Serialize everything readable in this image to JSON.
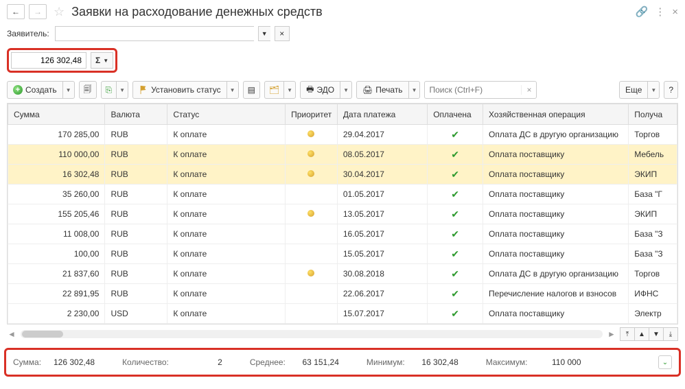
{
  "title": "Заявки на расходование денежных средств",
  "filter": {
    "label": "Заявитель:"
  },
  "sum_field": "126 302,48",
  "toolbar": {
    "create": "Создать",
    "set_status": "Установить статус",
    "edo": "ЭДО",
    "print": "Печать",
    "search_placeholder": "Поиск (Ctrl+F)",
    "more": "Еще"
  },
  "columns": {
    "sum": "Сумма",
    "currency": "Валюта",
    "status": "Статус",
    "priority": "Приоритет",
    "pay_date": "Дата платежа",
    "paid": "Оплачена",
    "operation": "Хозяйственная операция",
    "recipient": "Получа"
  },
  "rows": [
    {
      "sum": "170 285,00",
      "cur": "RUB",
      "status": "К оплате",
      "bulb": true,
      "date": "29.04.2017",
      "paid": true,
      "op": "Оплата ДС в другую организацию",
      "recv": "Торгов",
      "sel": false
    },
    {
      "sum": "110 000,00",
      "cur": "RUB",
      "status": "К оплате",
      "bulb": true,
      "date": "08.05.2017",
      "paid": true,
      "op": "Оплата поставщику",
      "recv": "Мебель",
      "sel": true
    },
    {
      "sum": "16 302,48",
      "cur": "RUB",
      "status": "К оплате",
      "bulb": true,
      "date": "30.04.2017",
      "paid": true,
      "op": "Оплата поставщику",
      "recv": "ЭКИП",
      "sel": true
    },
    {
      "sum": "35 260,00",
      "cur": "RUB",
      "status": "К оплате",
      "bulb": false,
      "date": "01.05.2017",
      "paid": true,
      "op": "Оплата поставщику",
      "recv": "База \"Г",
      "sel": false
    },
    {
      "sum": "155 205,46",
      "cur": "RUB",
      "status": "К оплате",
      "bulb": true,
      "date": "13.05.2017",
      "paid": true,
      "op": "Оплата поставщику",
      "recv": "ЭКИП",
      "sel": false
    },
    {
      "sum": "11 008,00",
      "cur": "RUB",
      "status": "К оплате",
      "bulb": false,
      "date": "16.05.2017",
      "paid": true,
      "op": "Оплата поставщику",
      "recv": "База \"З",
      "sel": false
    },
    {
      "sum": "100,00",
      "cur": "RUB",
      "status": "К оплате",
      "bulb": false,
      "date": "15.05.2017",
      "paid": true,
      "op": "Оплата поставщику",
      "recv": "База \"З",
      "sel": false
    },
    {
      "sum": "21 837,60",
      "cur": "RUB",
      "status": "К оплате",
      "bulb": true,
      "date": "30.08.2018",
      "paid": true,
      "op": "Оплата ДС в другую организацию",
      "recv": "Торгов",
      "sel": false
    },
    {
      "sum": "22 891,95",
      "cur": "RUB",
      "status": "К оплате",
      "bulb": false,
      "date": "22.06.2017",
      "paid": true,
      "op": "Перечисление налогов и взносов",
      "recv": "ИФНС",
      "sel": false
    },
    {
      "sum": "2 230,00",
      "cur": "USD",
      "status": "К оплате",
      "bulb": false,
      "date": "15.07.2017",
      "paid": true,
      "op": "Оплата поставщику",
      "recv": "Электр",
      "sel": false
    }
  ],
  "footer": {
    "sum_label": "Сумма:",
    "sum_value": "126 302,48",
    "count_label": "Количество:",
    "count_value": "2",
    "avg_label": "Среднее:",
    "avg_value": "63 151,24",
    "min_label": "Минимум:",
    "min_value": "16 302,48",
    "max_label": "Максимум:",
    "max_value": "110 000"
  }
}
